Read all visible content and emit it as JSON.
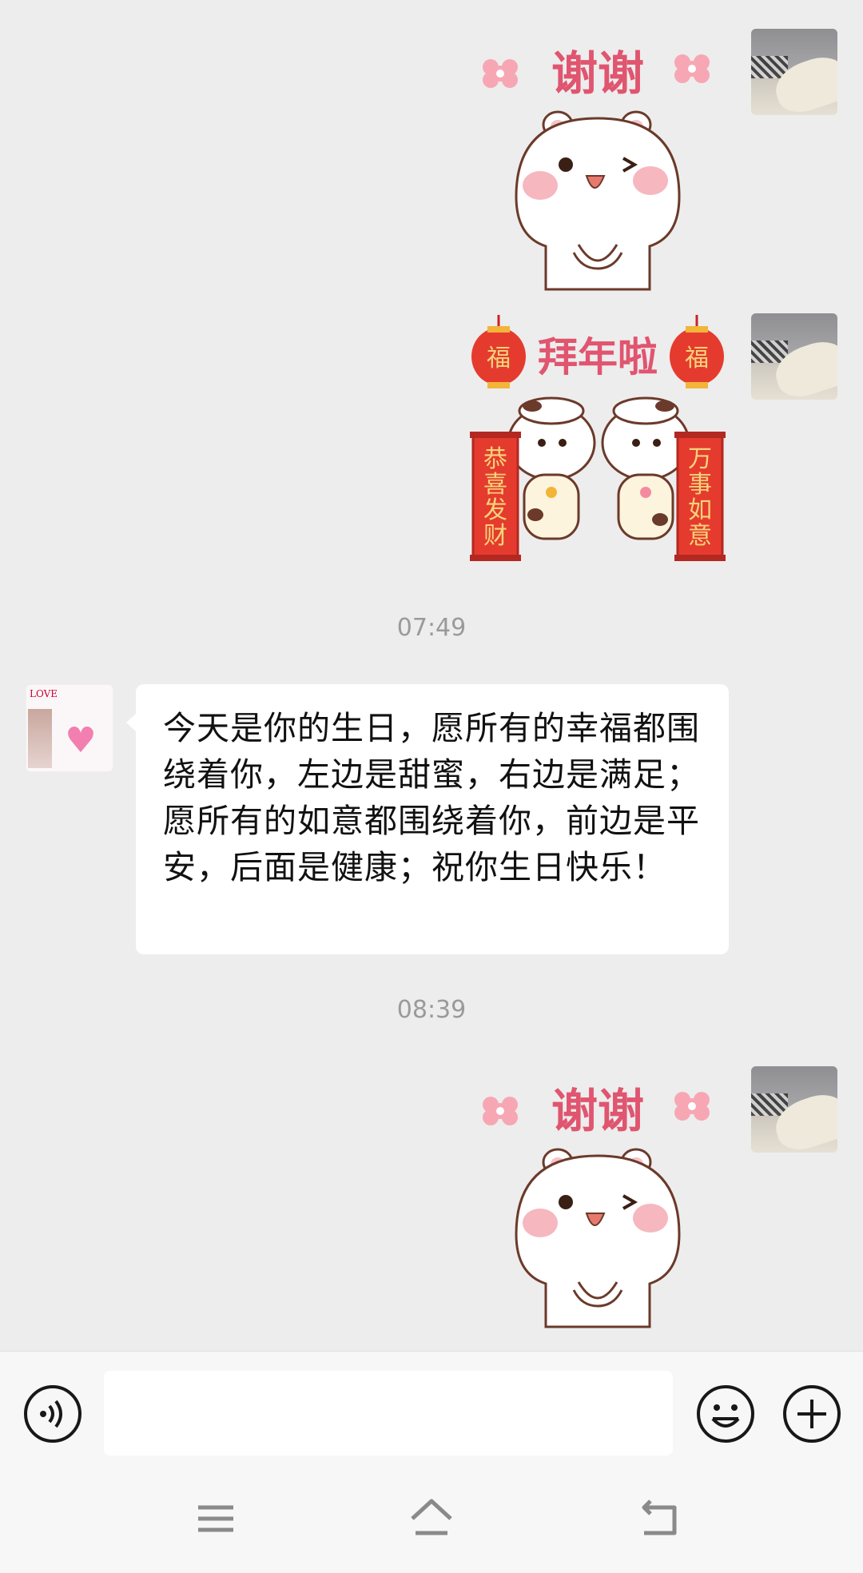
{
  "messages": [
    {
      "type": "sticker",
      "sender": "me",
      "caption": "谢谢"
    },
    {
      "type": "sticker",
      "sender": "me",
      "caption": "拜年啦",
      "scroll_left": [
        "恭",
        "喜",
        "发",
        "财"
      ],
      "scroll_right": [
        "万",
        "事",
        "如",
        "意"
      ],
      "lantern": "福"
    },
    {
      "type": "time",
      "text": "07:49"
    },
    {
      "type": "text",
      "sender": "other",
      "text": "今天是你的生日，愿所有的幸福都围绕着你，左边是甜蜜，右边是满足；愿所有的如意都围绕着你，前边是平安，后面是健康；祝你生日快乐！"
    },
    {
      "type": "time",
      "text": "08:39"
    },
    {
      "type": "sticker",
      "sender": "me",
      "caption": "谢谢"
    }
  ],
  "input": {
    "value": "",
    "placeholder": ""
  },
  "icons": {
    "voice": "voice-icon",
    "emoji": "emoji-icon",
    "more": "plus-icon",
    "nav_menu": "menu-icon",
    "nav_home": "home-icon",
    "nav_back": "back-icon"
  },
  "colors": {
    "chat_bg": "#ededed",
    "bubble": "#ffffff",
    "caption": "#e0556f",
    "scroll": "#e53b2e",
    "scroll_text": "#f6d37a"
  }
}
